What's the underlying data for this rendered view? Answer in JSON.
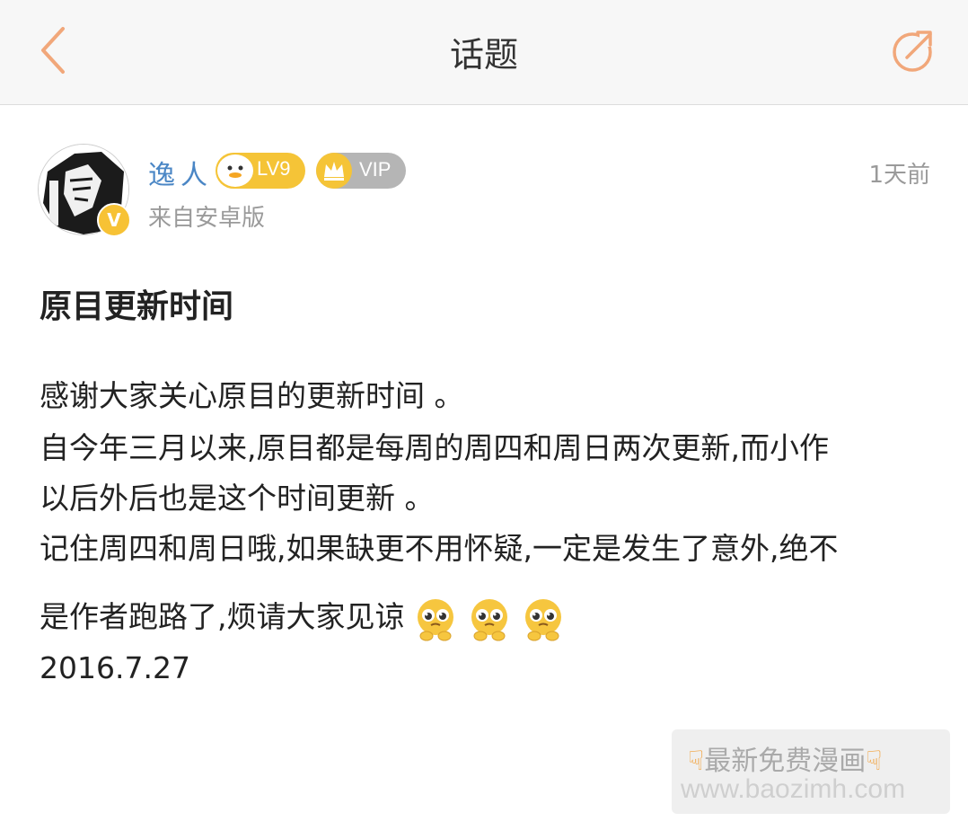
{
  "header": {
    "title": "话题",
    "back_icon": "chevron-left-icon",
    "share_icon": "share-icon",
    "accent_color": "#f1a77a"
  },
  "post": {
    "author": {
      "name": "逸人",
      "level_badge": "LV9",
      "vip_badge": "VIP",
      "verified_badge": "V",
      "source": "来自安卓版"
    },
    "time": "1天前",
    "title": "原目更新时间",
    "body_lines": [
      "感谢大家关心原目的更新时间 。",
      "自今年三月以来,原目都是每周的周四和周日两次更新,而小作",
      "以后外后也是这个时间更新 。",
      "记住周四和周日哦,如果缺更不用怀疑,一定是发生了意外,绝不",
      "是作者跑路了,烦请大家见谅",
      "2016.7.27"
    ],
    "emoji_count": 3,
    "emoji_icon": "pleading-face-emoji"
  },
  "watermark": {
    "line1": "最新免费漫画",
    "line2": "www.baozimh.com",
    "icon": "pointing-down-hand-icon"
  }
}
